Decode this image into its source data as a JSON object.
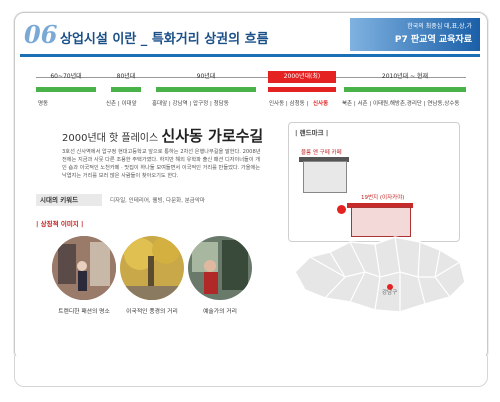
{
  "header": {
    "number": "06",
    "title": "상업시설 이란 _ 특화거리 상권의 흐름",
    "sub": "한국의 최중심 대,표,상,가",
    "name": "P7 판교역 교육자료"
  },
  "timeline": {
    "eras": [
      {
        "label": "60~70년대"
      },
      {
        "label": "80년대"
      },
      {
        "label": "90년대"
      },
      {
        "label": "2000년대(최)",
        "hot": true
      },
      {
        "label": "2010년대 ~ 현재"
      }
    ],
    "places": [
      {
        "label": "명동"
      },
      {
        "label": "신촌 | 이대앞"
      },
      {
        "label": "홍대앞 | 강남역 | 압구정 | 청담동"
      },
      {
        "label": "인사동 | 삼청동 |"
      },
      {
        "label": "신사동",
        "hot": true
      },
      {
        "label": "북촌 | 서촌 | 이태원,해방촌,경리단 | 연남동,상수동"
      }
    ]
  },
  "main": {
    "title_prefix": "2000년대 핫 플레이스",
    "title_main": "신사동 가로수길",
    "description": "3호선 신사역에서 압구정 현대고등학교 앞으로 통하는 2차선 은행나무길을 말한다. 2008년 전에는 지금과 사뭇 다른 조용한 주택가였다. 하지만 해외 유학파 출신 패션 디자이너들이 개인 숍과 이국적인 노천카페 · 맛집이 하나둘 모여들면서 이국적인 거리를 만들었다. 가을에는 낙엽지는 거리를 보러 많은 사람들이 찾아오기도 한다.",
    "keyword_label": "시대의 키워드",
    "keywords": "디자일, 인테리어, 웰빙, 다문화, 분금악마",
    "symbol_label": "| 상징적 이미지 |",
    "captions": [
      "트렌디한 패션의 명소",
      "이국적인 풍경의 거리",
      "예술가의 거리"
    ]
  },
  "landmark": {
    "title": "| 랜드마크 |",
    "cafe": "블룸 앤 구떼 카페",
    "address": "19번지 (이자카야)",
    "map_label": "강남구"
  }
}
